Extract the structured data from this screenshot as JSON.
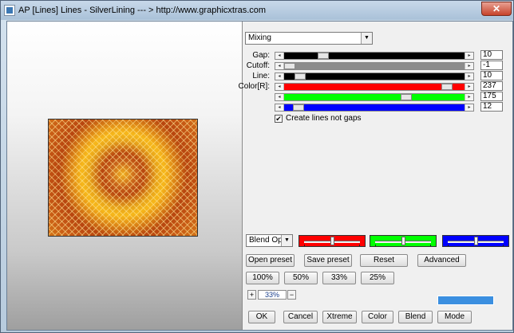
{
  "window": {
    "title": "AP [Lines]  Lines - SilverLining    --- > http://www.graphicxtras.com",
    "close_label": "✕"
  },
  "mode_select": {
    "value": "Mixing"
  },
  "sliders": [
    {
      "label": "Gap:",
      "value": "10",
      "thumb_fraction": 0.2,
      "fill": "#000000"
    },
    {
      "label": "Cutoff:",
      "value": "-1",
      "thumb_fraction": 0.0,
      "fill": "#8c8c8c"
    },
    {
      "label": "Line:",
      "value": "10",
      "thumb_fraction": 0.06,
      "fill": "#000000"
    },
    {
      "label": "Color[R]:",
      "value": "237",
      "thumb_fraction": 0.93,
      "fill": "#ff0000"
    },
    {
      "label": "",
      "value": "175",
      "thumb_fraction": 0.69,
      "fill": "#00ff00"
    },
    {
      "label": "",
      "value": "12",
      "thumb_fraction": 0.05,
      "fill": "#0000ff"
    }
  ],
  "checkbox": {
    "label": "Create lines not gaps",
    "checked": "✔"
  },
  "blend_select": {
    "value": "Blend Optio"
  },
  "color_sliders": [
    {
      "color": "#ff0000",
      "level": 0.5
    },
    {
      "color": "#00ff00",
      "level": 0.5
    },
    {
      "color": "#0000ff",
      "level": 0.5
    }
  ],
  "buttons_row1": [
    "Open preset",
    "Save preset",
    "Reset",
    "Advanced"
  ],
  "buttons_zoom": [
    "100%",
    "50%",
    "33%",
    "25%"
  ],
  "zoom": {
    "plus": "+",
    "value": "33%",
    "minus": "−"
  },
  "bottom_buttons": [
    "OK",
    "Cancel",
    "Xtreme",
    "Color",
    "Blend",
    "Mode"
  ],
  "colors": {
    "accent_bar": "#3b8fe0"
  }
}
